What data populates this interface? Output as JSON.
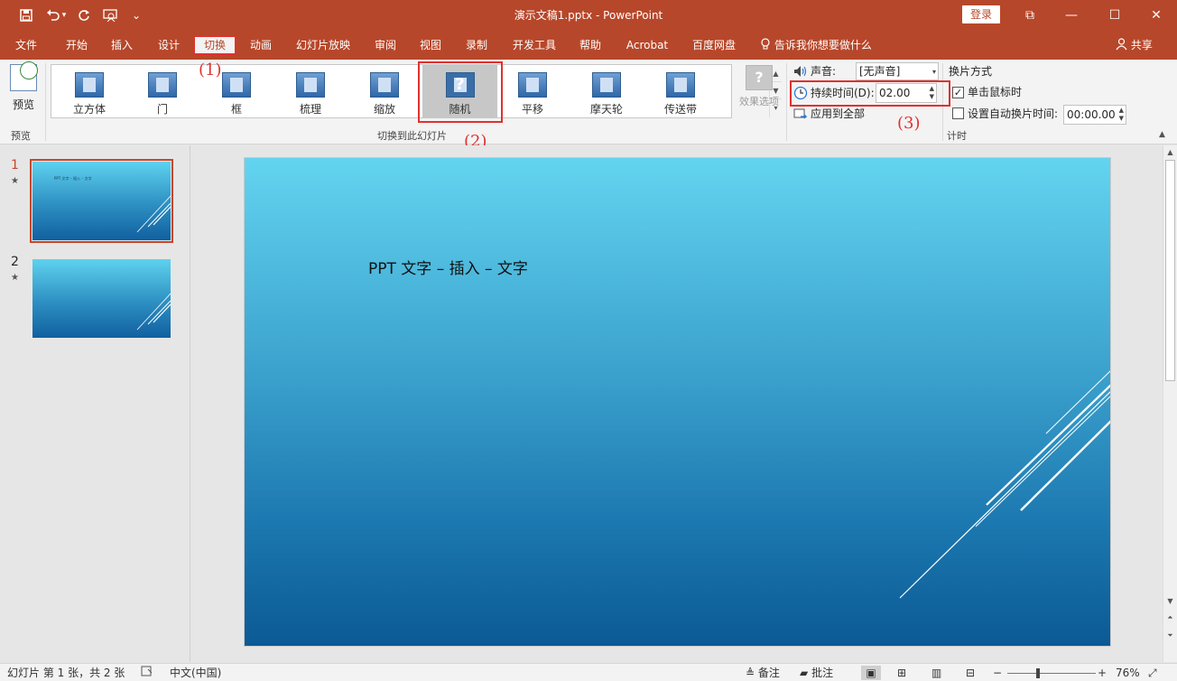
{
  "window": {
    "title": "演示文稿1.pptx  -  PowerPoint",
    "login_label": "登录",
    "minimize_glyph": "—",
    "restore_glyph": "☐",
    "close_glyph": "✕",
    "ribbon_display_glyph": "⧉"
  },
  "qat": {
    "save_icon": "save-icon",
    "undo_icon": "undo-icon",
    "redo_icon": "redo-icon",
    "present_icon": "present-icon",
    "customize_glyph": "⌄"
  },
  "menu": {
    "items": [
      "文件",
      "开始",
      "插入",
      "设计",
      "切换",
      "动画",
      "幻灯片放映",
      "审阅",
      "视图",
      "录制",
      "开发工具",
      "帮助",
      "Acrobat",
      "百度网盘"
    ],
    "active": "切换",
    "tell_me": "告诉我你想要做什么",
    "share": "共享"
  },
  "ribbon": {
    "preview_label": "预览",
    "preview_group_label": "预览",
    "transitions": [
      "立方体",
      "门",
      "框",
      "梳理",
      "缩放",
      "随机",
      "平移",
      "摩天轮",
      "传送带"
    ],
    "selected_transition": "随机",
    "random_glyph": "?",
    "gallery_group_label": "切换到此幻灯片",
    "effect_options_label": "效果选项",
    "sound_label": "声音:",
    "sound_value": "[无声音]",
    "duration_label": "持续时间(D):",
    "duration_value": "02.00",
    "apply_all_label": "应用到全部",
    "advance_title": "换片方式",
    "on_click_label": "单击鼠标时",
    "on_click_checked": true,
    "after_label": "设置自动换片时间:",
    "after_value": "00:00.00",
    "timing_group_label": "计时"
  },
  "annotations": [
    "(1)",
    "(2)",
    "(3)"
  ],
  "slides": [
    {
      "number": "1",
      "star": "★",
      "mini_text": "PPT 文字 – 插入 – 文字"
    },
    {
      "number": "2",
      "star": "★",
      "mini_text": ""
    }
  ],
  "main_slide": {
    "text": "PPT 文字 – 插入 – 文字"
  },
  "status": {
    "slide_info": "幻灯片 第 1 张，共 2 张",
    "language": "中文(中国)",
    "notes_label": "备注",
    "comments_label": "批注",
    "zoom": "76%",
    "zoom_minus": "−",
    "zoom_plus": "+"
  },
  "colors": {
    "accent": "#b7472a",
    "annotation_red": "#e0312f"
  }
}
